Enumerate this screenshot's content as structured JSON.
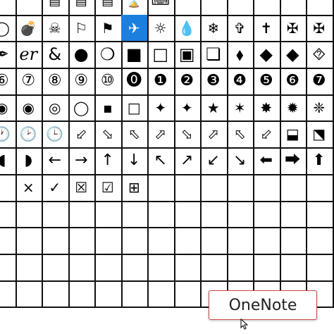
{
  "symbol_grid": {
    "selected": "✈",
    "rows": [
      [
        "",
        "",
        "▤",
        "▤",
        "▤",
        "⌛",
        "⌨",
        "",
        "",
        "",
        ""
      ],
      [
        "◯",
        "💣",
        "☠",
        "⚐",
        "⚑",
        "✈",
        "☼",
        "💧",
        "❄",
        "✞",
        "✝",
        "✠",
        "✠"
      ],
      [
        "✒",
        "er",
        "&",
        "●",
        "❍",
        "■",
        "□",
        "▣",
        "❏",
        "⬧",
        "◆",
        "◆",
        "⯑"
      ],
      [
        "⑥",
        "⑦",
        "⑧",
        "⑨",
        "⑩",
        "⓿",
        "❶",
        "❷",
        "❸",
        "❹",
        "❺",
        "❻",
        "❼"
      ],
      [
        "◉",
        "◉",
        "◎",
        "◯",
        "▪",
        "□",
        "✦",
        "✦",
        "★",
        "✶",
        "✸",
        "✹",
        "❈"
      ],
      [
        "🕐",
        "🕑",
        "🕒",
        "⬃",
        "⬂",
        "⬁",
        "⬀",
        "⬂",
        "⬀",
        "⬁",
        "⬃",
        "⬓",
        "⬔"
      ],
      [
        "◖",
        "◗",
        "←",
        "→",
        "↑",
        "↓",
        "↖",
        "↗",
        "↙",
        "↘",
        "⬅",
        "⮕",
        "⬆"
      ],
      [
        "",
        "×",
        "✓",
        "☒",
        "☑",
        "⊞",
        "",
        "",
        "",
        "",
        "",
        "",
        ""
      ],
      [
        "",
        "",
        "",
        "",
        "",
        "",
        "",
        "",
        "",
        "",
        "",
        "",
        ""
      ],
      [
        "",
        "",
        "",
        "",
        "",
        "",
        "",
        "",
        "",
        "",
        "",
        "",
        ""
      ],
      [
        "",
        "",
        "",
        "",
        "",
        "",
        "",
        "",
        "",
        "",
        "",
        "",
        ""
      ],
      [
        "",
        "",
        "",
        "",
        "",
        "",
        "",
        "",
        "",
        "",
        "",
        "",
        ""
      ]
    ]
  },
  "tooltip": {
    "label": "OneNote"
  },
  "colors": {
    "selection": "#1b7fe0",
    "grid": "#111111",
    "tooltip_border": "#c94b4b"
  },
  "icons": {
    "cursor": "arrow-cursor-icon"
  }
}
